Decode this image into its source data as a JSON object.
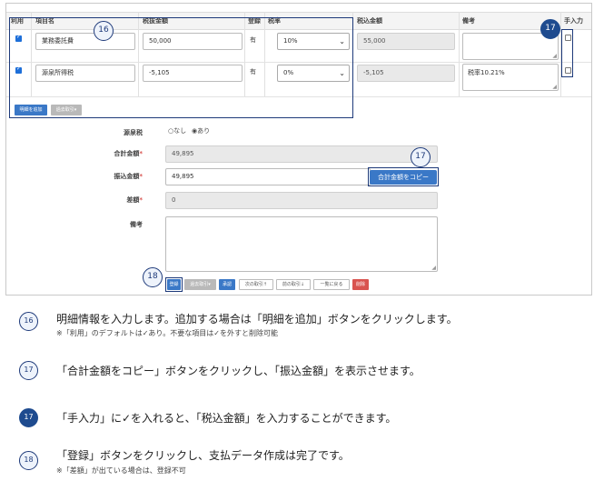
{
  "table": {
    "headers": {
      "use": "利用",
      "item": "項目名",
      "pretax": "税抜金額",
      "reg": "登録",
      "taxrate": "税率",
      "withtax": "税込金額",
      "memo": "備考",
      "manual": "手入力"
    },
    "rows": [
      {
        "use": true,
        "item": "業務委託費",
        "pretax": "50,000",
        "reg": "有",
        "taxrate": "10%",
        "withtax": "55,000",
        "memo": "",
        "manual": false
      },
      {
        "use": true,
        "item": "源泉所得税",
        "pretax": "-5,105",
        "reg": "有",
        "taxrate": "0%",
        "withtax": "-5,105",
        "memo": "税率10.21%",
        "manual": false
      }
    ],
    "add_detail": "明細を追加",
    "past_transactions": "過去取引▾"
  },
  "form": {
    "withholding": {
      "label": "源泉税",
      "option_none": "○なし",
      "option_yes": "◉あり"
    },
    "total": {
      "label": "合計金額",
      "value": "49,895"
    },
    "transfer": {
      "label": "振込金額",
      "value": "49,895",
      "copy_button": "合計金額をコピー"
    },
    "difference": {
      "label": "差額",
      "value": "0"
    },
    "memo": {
      "label": "備考"
    },
    "required_mark": "*"
  },
  "actions": {
    "register": "登録",
    "past": "過去取引▾",
    "approve": "承認",
    "next": "次の取引↑",
    "prev": "前の取引↓",
    "back_to_list": "一覧に戻る",
    "delete": "削除"
  },
  "callouts": {
    "c16": "16",
    "c17a": "17",
    "c17b": "17",
    "c18": "18"
  },
  "notes": [
    {
      "num": "16",
      "filled": false,
      "main": "明細情報を入力します。追加する場合は「明細を追加」ボタンをクリックします。",
      "sub": "※「利用」のデフォルトは✓あり。不要な項目は✓を外すと削除可能"
    },
    {
      "num": "17",
      "filled": false,
      "main": "「合計金額をコピー」ボタンをクリックし、「振込金額」を表示させます。",
      "sub": ""
    },
    {
      "num": "17",
      "filled": true,
      "main": "「手入力」に✓を入れると、「税込金額」を入力することができます。",
      "sub": ""
    },
    {
      "num": "18",
      "filled": false,
      "main": "「登録」ボタンをクリックし、支払データ作成は完了です。",
      "sub": "※「差額」が出ている場合は、登録不可"
    }
  ],
  "colors": {
    "accent": "#1e4b8f",
    "primary_button": "#3a78c7",
    "danger": "#d9534f"
  }
}
